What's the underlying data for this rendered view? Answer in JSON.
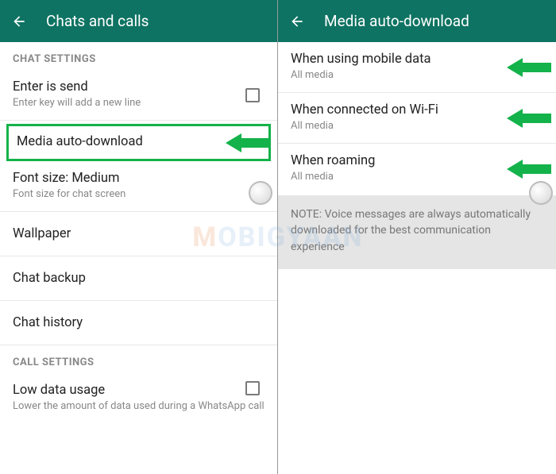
{
  "left": {
    "appbar_title": "Chats and calls",
    "sections": {
      "chat_header": "CHAT SETTINGS",
      "call_header": "CALL SETTINGS"
    },
    "items": {
      "enter_send": {
        "title": "Enter is send",
        "subtitle": "Enter key will add a new line"
      },
      "media_auto": {
        "title": "Media auto-download"
      },
      "font_size": {
        "title": "Font size: Medium",
        "subtitle": "Font size for chat screen"
      },
      "wallpaper": {
        "title": "Wallpaper"
      },
      "chat_backup": {
        "title": "Chat backup"
      },
      "chat_history": {
        "title": "Chat history"
      },
      "low_data": {
        "title": "Low data usage",
        "subtitle": "Lower the amount of data used during a WhatsApp call"
      }
    }
  },
  "right": {
    "appbar_title": "Media auto-download",
    "items": {
      "mobile": {
        "title": "When using mobile data",
        "subtitle": "All media"
      },
      "wifi": {
        "title": "When connected on Wi-Fi",
        "subtitle": "All media"
      },
      "roaming": {
        "title": "When roaming",
        "subtitle": "All media"
      }
    },
    "note": "NOTE: Voice messages are always automatically downloaded for the best communication experience"
  },
  "watermark": "MOBIGYAAN",
  "colors": {
    "appbar": "#0e7362",
    "arrow": "#14b24a"
  }
}
